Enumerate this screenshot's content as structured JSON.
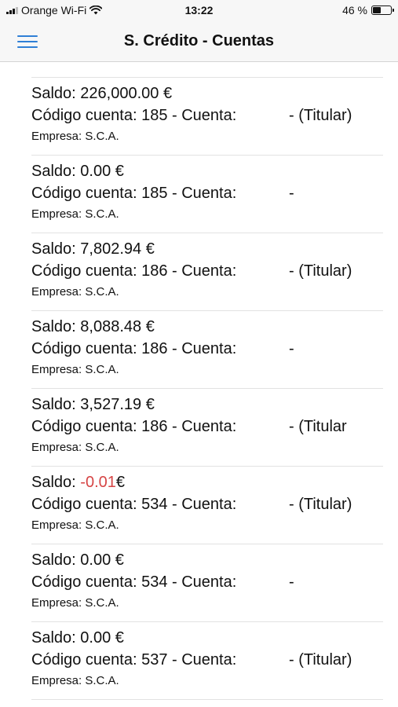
{
  "status_bar": {
    "carrier": "Orange Wi-Fi",
    "time": "13:22",
    "battery": "46 %",
    "battery_level": 0.46
  },
  "header": {
    "title": "S. Crédito - Cuentas",
    "menu_icon": "hamburger-menu-icon",
    "accent_color": "#2f7fd6"
  },
  "accounts": [
    {
      "saldo_label": "Saldo:",
      "saldo_value": "226,000.00",
      "currency": "€",
      "cuenta_line": "Código cuenta: 185 - Cuenta:",
      "titular": "- (Titular)",
      "empresa": "Empresa: S.C.A."
    },
    {
      "saldo_label": "Saldo:",
      "saldo_value": "0.00",
      "currency": "€",
      "cuenta_line": "Código cuenta: 185 - Cuenta:",
      "titular": "-",
      "empresa": "Empresa: S.C.A."
    },
    {
      "saldo_label": "Saldo:",
      "saldo_value": "7,802.94",
      "currency": "€",
      "cuenta_line": "Código cuenta: 186 - Cuenta:",
      "titular": "- (Titular)",
      "empresa": "Empresa: S.C.A."
    },
    {
      "saldo_label": "Saldo:",
      "saldo_value": "8,088.48",
      "currency": "€",
      "cuenta_line": "Código cuenta: 186 - Cuenta:",
      "titular": "-",
      "empresa": "Empresa: S.C.A."
    },
    {
      "saldo_label": "Saldo:",
      "saldo_value": "3,527.19",
      "currency": "€",
      "cuenta_line": "Código cuenta: 186 - Cuenta:",
      "titular": "- (Titular",
      "empresa": "Empresa: S.C.A."
    },
    {
      "saldo_label": "Saldo:",
      "saldo_value": "-0.01",
      "currency": "€",
      "cuenta_line": "Código cuenta: 534 - Cuenta:",
      "titular": "- (Titular)",
      "empresa": "Empresa: S.C.A.",
      "negative_color": "#d64545"
    },
    {
      "saldo_label": "Saldo:",
      "saldo_value": "0.00",
      "currency": "€",
      "cuenta_line": "Código cuenta: 534 - Cuenta:",
      "titular": "-",
      "empresa": "Empresa: S.C.A."
    },
    {
      "saldo_label": "Saldo:",
      "saldo_value": "0.00",
      "currency": "€",
      "cuenta_line": "Código cuenta: 537 - Cuenta:",
      "titular": "- (Titular)",
      "empresa": "Empresa: S.C.A."
    }
  ]
}
